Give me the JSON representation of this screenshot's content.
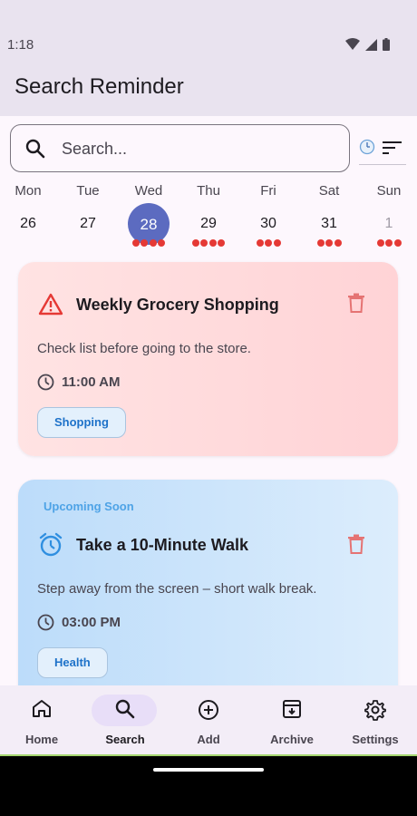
{
  "status_bar": {
    "time": "1:18"
  },
  "app_bar": {
    "title": "Search Reminder"
  },
  "search": {
    "placeholder": "Search..."
  },
  "calendar": {
    "days": [
      {
        "name": "Mon",
        "num": "26",
        "dots": 0
      },
      {
        "name": "Tue",
        "num": "27",
        "dots": 0
      },
      {
        "name": "Wed",
        "num": "28",
        "dots": 4,
        "selected": true
      },
      {
        "name": "Thu",
        "num": "29",
        "dots": 4
      },
      {
        "name": "Fri",
        "num": "30",
        "dots": 3
      },
      {
        "name": "Sat",
        "num": "31",
        "dots": 3
      },
      {
        "name": "Sun",
        "num": "1",
        "dots": 3,
        "faded": true
      }
    ]
  },
  "reminders": [
    {
      "title": "Weekly Grocery Shopping",
      "description": "Check list before going to the store.",
      "time": "11:00 AM",
      "tag": "Shopping",
      "icon": "warning-icon"
    },
    {
      "badge": "Upcoming Soon",
      "title": "Take a 10-Minute Walk",
      "description": "Step away from the screen – short walk break.",
      "time": "03:00 PM",
      "tag": "Health",
      "icon": "alarm-icon"
    }
  ],
  "nav": {
    "items": [
      {
        "label": "Home",
        "icon": "home-icon"
      },
      {
        "label": "Search",
        "icon": "search-icon",
        "active": true
      },
      {
        "label": "Add",
        "icon": "add-circle-icon"
      },
      {
        "label": "Archive",
        "icon": "archive-icon"
      },
      {
        "label": "Settings",
        "icon": "gear-icon"
      }
    ]
  },
  "colors": {
    "accent": "#5c6bc0",
    "danger": "#e53935",
    "chip_text": "#1e72c9",
    "upcoming": "#4ea3e6"
  }
}
